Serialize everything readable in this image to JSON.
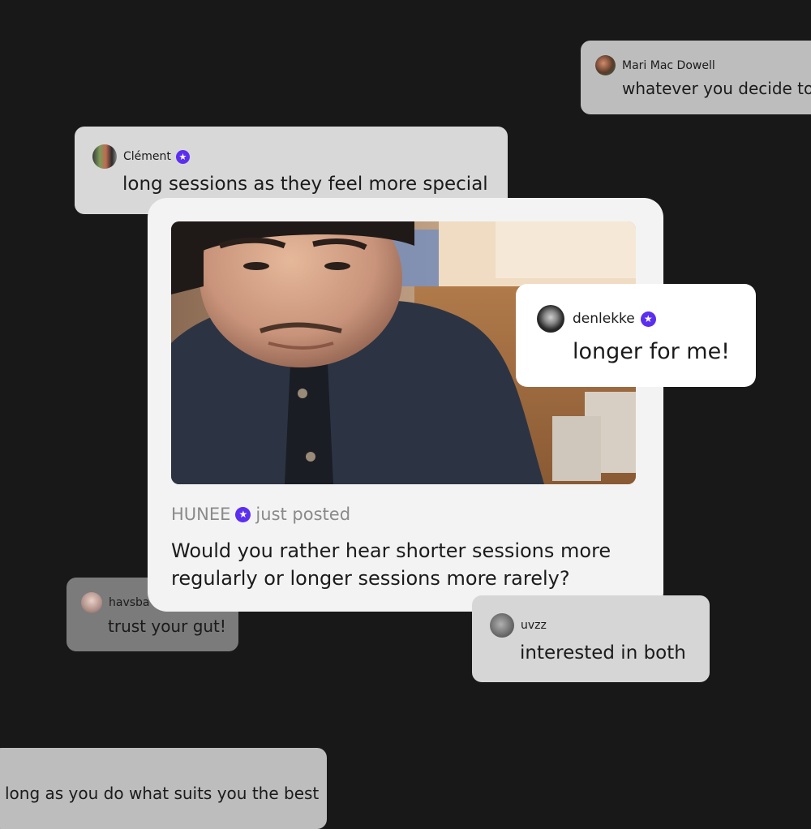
{
  "comments": {
    "mari": {
      "username": "Mari Mac Dowell",
      "text": "whatever you decide to"
    },
    "clement": {
      "username": "Clément",
      "text": "long sessions as they feel more special"
    },
    "denlekke": {
      "username": "denlekke",
      "text": "longer for me!"
    },
    "havsba": {
      "username": "havsba",
      "text": "trust your gut!"
    },
    "uvzz": {
      "username": "uvzz",
      "text": "interested in both"
    },
    "bottom": {
      "text": "long as you do what suits you the best"
    }
  },
  "post": {
    "author": "HUNEE",
    "status": "just posted",
    "text": "Would you rather hear shorter sessions more regularly or longer sessions more rarely?",
    "image": "man-looking-down-at-records-photo"
  },
  "icons": {
    "verified": "verified-star-badge-icon"
  },
  "colors": {
    "background": "#181818",
    "badge": "#5b2ef0",
    "card": "#f3f3f3"
  }
}
